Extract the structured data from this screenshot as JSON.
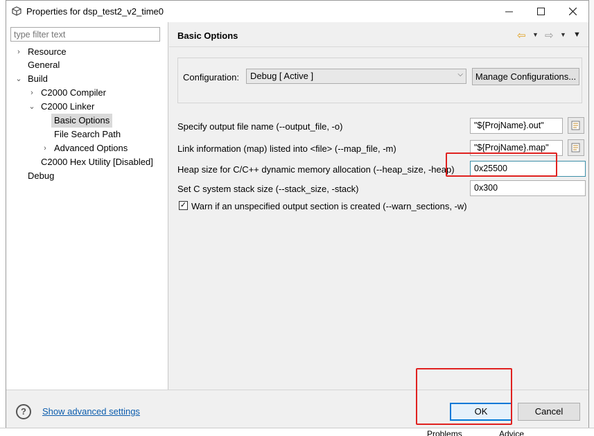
{
  "window": {
    "title": "Properties for dsp_test2_v2_time0"
  },
  "filter": {
    "placeholder": "type filter text"
  },
  "tree": {
    "resource": "Resource",
    "general": "General",
    "build": "Build",
    "compiler": "C2000 Compiler",
    "linker": "C2000 Linker",
    "basic_options": "Basic Options",
    "file_search_path": "File Search Path",
    "advanced_options": "Advanced Options",
    "hex_utility": "C2000 Hex Utility  [Disabled]",
    "debug": "Debug"
  },
  "page": {
    "title": "Basic Options"
  },
  "config": {
    "label": "Configuration:",
    "selected": "Debug  [ Active ]",
    "manage_button": "Manage Configurations..."
  },
  "options": {
    "output_file_label": "Specify output file name (--output_file, -o)",
    "output_file_value": "\"${ProjName}.out\"",
    "map_file_label": "Link information (map) listed into <file> (--map_file, -m)",
    "map_file_value": "\"${ProjName}.map\"",
    "heap_label": "Heap size for C/C++ dynamic memory allocation (--heap_size, -heap)",
    "heap_value": "0x25500",
    "stack_label": "Set C system stack size (--stack_size, -stack)",
    "stack_value": "0x300",
    "warn_label": "Warn if an unspecified output section is created (--warn_sections, -w)",
    "warn_checked": true
  },
  "footer": {
    "advanced_link": "Show advanced settings",
    "ok": "OK",
    "cancel": "Cancel"
  },
  "background": {
    "problems_tab": "Problems",
    "advice_tab": "Advice"
  }
}
